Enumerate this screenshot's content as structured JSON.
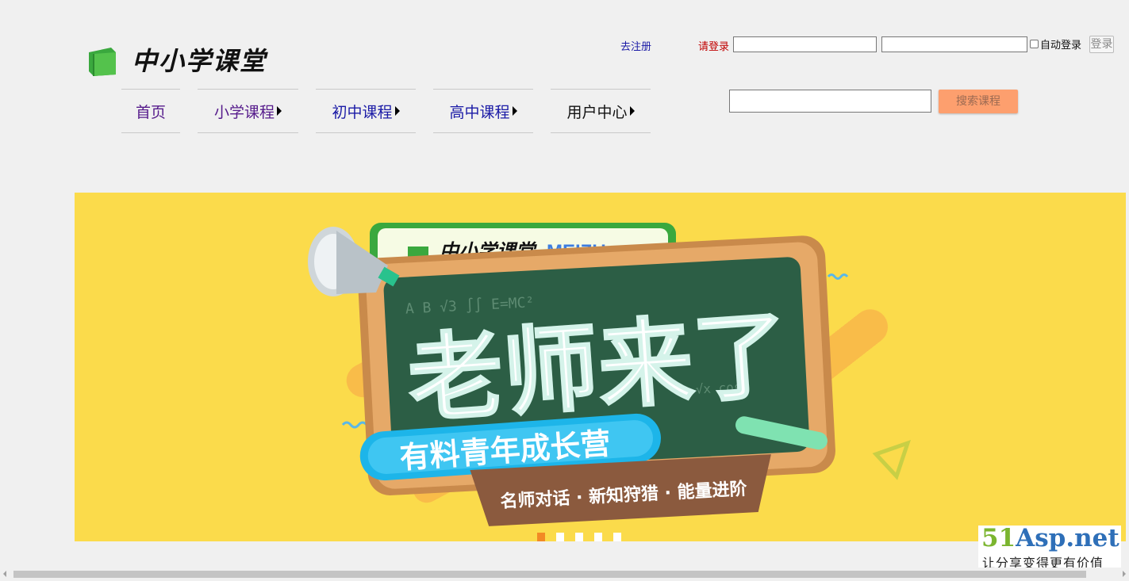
{
  "logo": {
    "brand": "中小学课堂"
  },
  "header": {
    "register_link": "去注册",
    "login_prompt": "请登录",
    "username_value": "",
    "password_value": "",
    "auto_login_label": "自动登录",
    "login_button": "登录"
  },
  "nav": {
    "items": [
      {
        "label": "首页",
        "has_dropdown": false,
        "color": "#551a8b"
      },
      {
        "label": "小学课程",
        "has_dropdown": true,
        "color": "#551a8b"
      },
      {
        "label": "初中课程",
        "has_dropdown": true,
        "color": "#1a1aa6"
      },
      {
        "label": "高中课程",
        "has_dropdown": true,
        "color": "#1a1aa6"
      },
      {
        "label": "用户中心",
        "has_dropdown": true,
        "color": "#111111"
      }
    ]
  },
  "search": {
    "value": "",
    "button_label": "搜索课程"
  },
  "banner": {
    "brand_text": "中小学课堂",
    "partner_text": "MEIZU",
    "headline": "老师来了",
    "subtitle": "有料青年成长营",
    "tagline": "名师对话 · 新知狩猎 · 能量进阶",
    "background_color": "#fbdb4b",
    "carousel": {
      "count": 5,
      "active_index": 0
    }
  },
  "watermark": {
    "title_green": "51",
    "title_blue": "Asp.net",
    "slogan": "让分享变得更有价值"
  },
  "colors": {
    "accent_orange": "#fd9f6e",
    "link_blue": "#1a1aa6",
    "visited_purple": "#551a8b",
    "alert_red": "#c00000"
  }
}
